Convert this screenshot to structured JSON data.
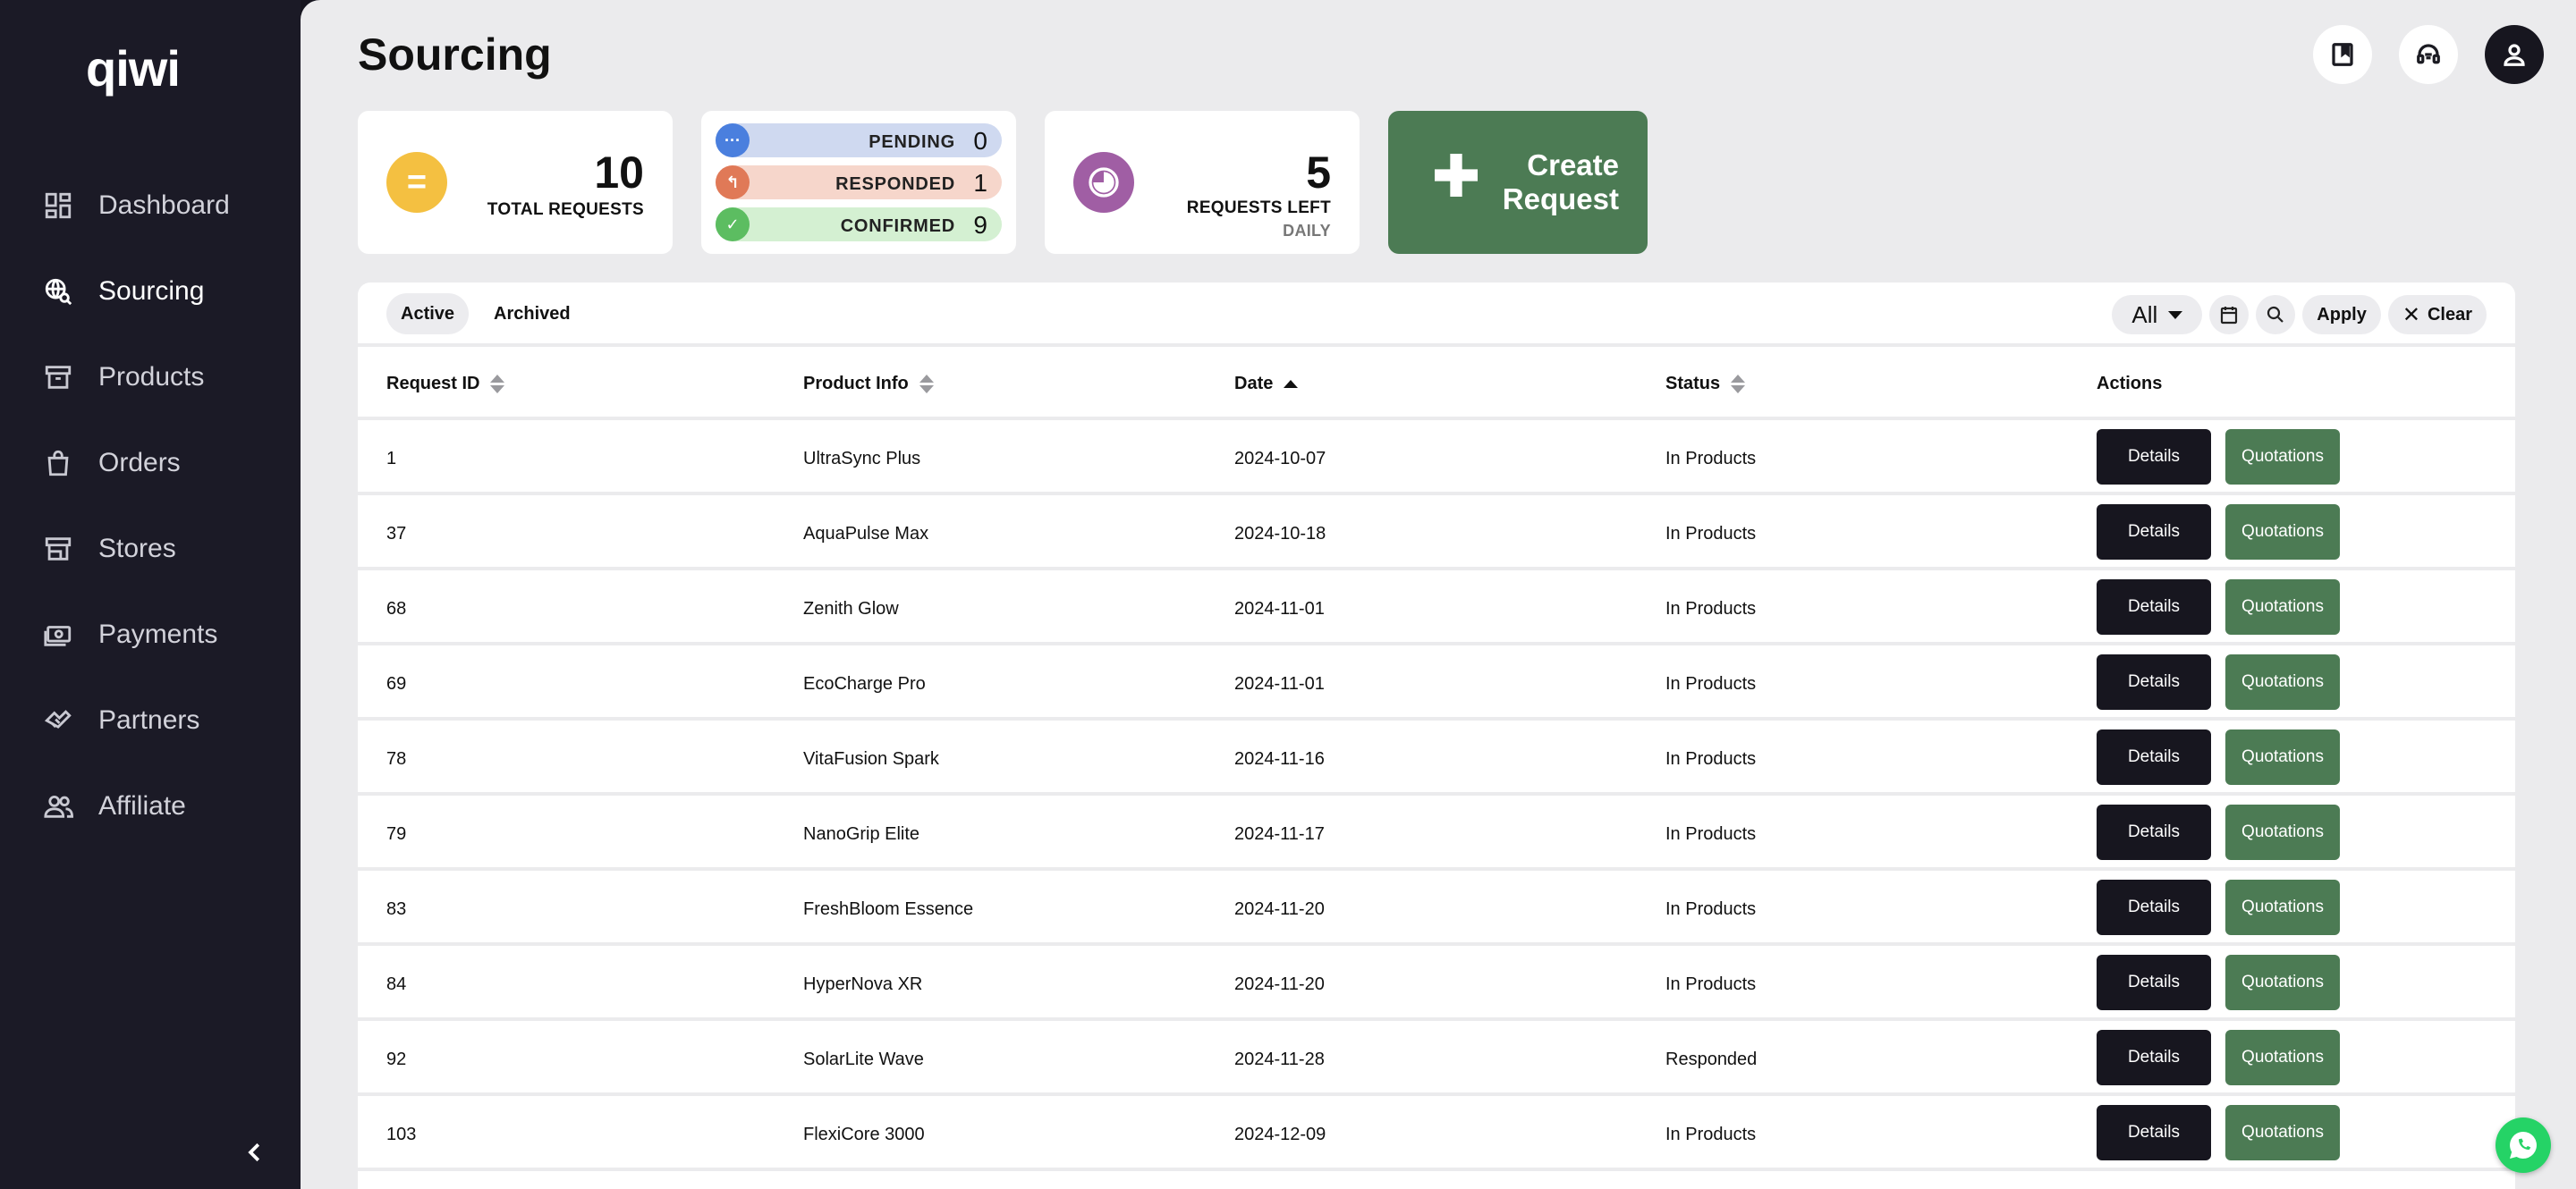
{
  "app": {
    "logo": "qiwi"
  },
  "sidebar": {
    "items": [
      {
        "label": "Dashboard",
        "icon": "dashboard-icon",
        "active": false
      },
      {
        "label": "Sourcing",
        "icon": "sourcing-icon",
        "active": true
      },
      {
        "label": "Products",
        "icon": "archive-box-icon",
        "active": false
      },
      {
        "label": "Orders",
        "icon": "shopping-bag-icon",
        "active": false
      },
      {
        "label": "Stores",
        "icon": "store-icon",
        "active": false
      },
      {
        "label": "Payments",
        "icon": "payments-icon",
        "active": false
      },
      {
        "label": "Partners",
        "icon": "handshake-icon",
        "active": false
      },
      {
        "label": "Affiliate",
        "icon": "users-icon",
        "active": false
      }
    ],
    "collapse_icon": "chevron-left-icon"
  },
  "header": {
    "title": "Sourcing",
    "icons": [
      "bookmark-icon",
      "support-headset-icon",
      "user-icon"
    ]
  },
  "stats": {
    "total": {
      "value": "10",
      "label": "TOTAL REQUESTS",
      "icon": "equals-icon",
      "color": "#f4c041"
    },
    "status": [
      {
        "label": "PENDING",
        "value": "0",
        "icon": "dots-icon",
        "color": "#4a7fde"
      },
      {
        "label": "RESPONDED",
        "value": "1",
        "icon": "reply-icon",
        "color": "#e07957"
      },
      {
        "label": "CONFIRMED",
        "value": "9",
        "icon": "check-icon",
        "color": "#5cbd61"
      }
    ],
    "requests_left": {
      "value": "5",
      "label": "REQUESTS LEFT",
      "sublabel": "DAILY",
      "icon": "pie-icon",
      "color": "#a05ea4"
    }
  },
  "create_button": {
    "label": "Create Request"
  },
  "toolbar": {
    "tabs": [
      {
        "label": "Active",
        "active": true
      },
      {
        "label": "Archived",
        "active": false
      }
    ],
    "filter_select": "All",
    "apply_label": "Apply",
    "clear_label": "Clear"
  },
  "table": {
    "columns": [
      "Request ID",
      "Product Info",
      "Date",
      "Status",
      "Actions"
    ],
    "sorted_column": "Date",
    "details_label": "Details",
    "quotations_label": "Quotations",
    "rows": [
      {
        "id": "1",
        "product": "UltraSync Plus",
        "date": "2024-10-07",
        "status": "In Products"
      },
      {
        "id": "37",
        "product": "AquaPulse Max",
        "date": "2024-10-18",
        "status": "In Products"
      },
      {
        "id": "68",
        "product": "Zenith Glow",
        "date": "2024-11-01",
        "status": "In Products"
      },
      {
        "id": "69",
        "product": "EcoCharge Pro",
        "date": "2024-11-01",
        "status": "In Products"
      },
      {
        "id": "78",
        "product": "VitaFusion Spark",
        "date": "2024-11-16",
        "status": "In Products"
      },
      {
        "id": "79",
        "product": "NanoGrip Elite",
        "date": "2024-11-17",
        "status": "In Products"
      },
      {
        "id": "83",
        "product": "FreshBloom Essence",
        "date": "2024-11-20",
        "status": "In Products"
      },
      {
        "id": "84",
        "product": "HyperNova XR",
        "date": "2024-11-20",
        "status": "In Products"
      },
      {
        "id": "92",
        "product": "SolarLite Wave",
        "date": "2024-11-28",
        "status": "Responded"
      },
      {
        "id": "103",
        "product": "FlexiCore 3000",
        "date": "2024-12-09",
        "status": "In Products"
      }
    ]
  },
  "floating": {
    "icon": "whatsapp-icon"
  }
}
